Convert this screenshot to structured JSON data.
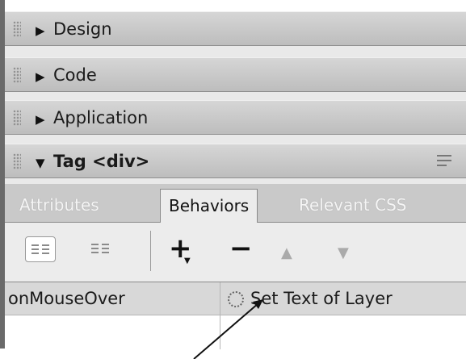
{
  "panel_groups": [
    {
      "label": "Design",
      "expanded": false
    },
    {
      "label": "Code",
      "expanded": false
    },
    {
      "label": "Application",
      "expanded": false
    },
    {
      "label": "Tag <div>",
      "expanded": true
    }
  ],
  "tabs": [
    "Attributes",
    "Behaviors",
    "Relevant CSS"
  ],
  "active_tab": "Behaviors",
  "toolbar": {
    "show_set_events_icon": "show-set-events-icon",
    "show_all_events_icon": "show-all-events-icon",
    "add_label": "+",
    "remove_label": "−",
    "move_up_label": "▲",
    "move_down_label": "▼"
  },
  "behaviors_table": {
    "rows": [
      {
        "event": "onMouseOver",
        "action": "Set Text of Layer"
      },
      {
        "event": "",
        "action": ""
      }
    ]
  }
}
